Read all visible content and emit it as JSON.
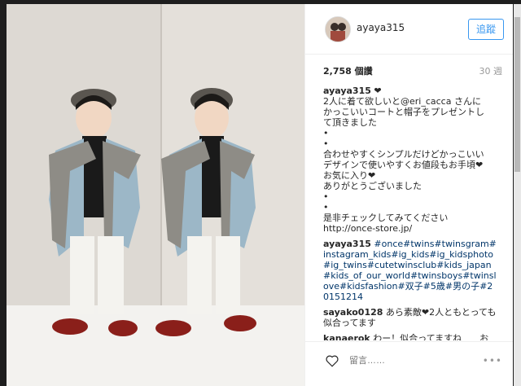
{
  "post": {
    "username": "ayaya315",
    "follow_label": "追蹤",
    "views": "2,758 個讚",
    "time": "30 週",
    "comments": [
      {
        "user": "ayaya315",
        "text": " ❤︎\n2人に着て欲しいと@eri_cacca さんに\nかっこいいコートと帽子をプレゼントし\nて頂きました\n•\n•\n合わせやすくシンプルだけどかっこいい\nデザインで使いやすくお値段もお手頃❤︎\nお気に入り❤︎\nありがとうございました\n•\n•\n是非チェックしてみてください\nhttp://once-store.jp/"
      },
      {
        "user": "ayaya315",
        "text": " #once#twins#twinsgram#instagram_kids#ig_kids#ig_kidsphoto#ig_twins#cutetwinsclub#kids_japan#kids_of_our_world#twinsboys#twinslove#kidsfashion#双子#5歳#男の子#20151214"
      },
      {
        "user": "sayako0128",
        "text": " あら素敵❤︎2人ともとっても似合ってます"
      },
      {
        "user": "kanaerok",
        "text": " わー！似合ってますね　　お"
      }
    ],
    "comment_placeholder": "留言……",
    "more_label": "•••"
  }
}
